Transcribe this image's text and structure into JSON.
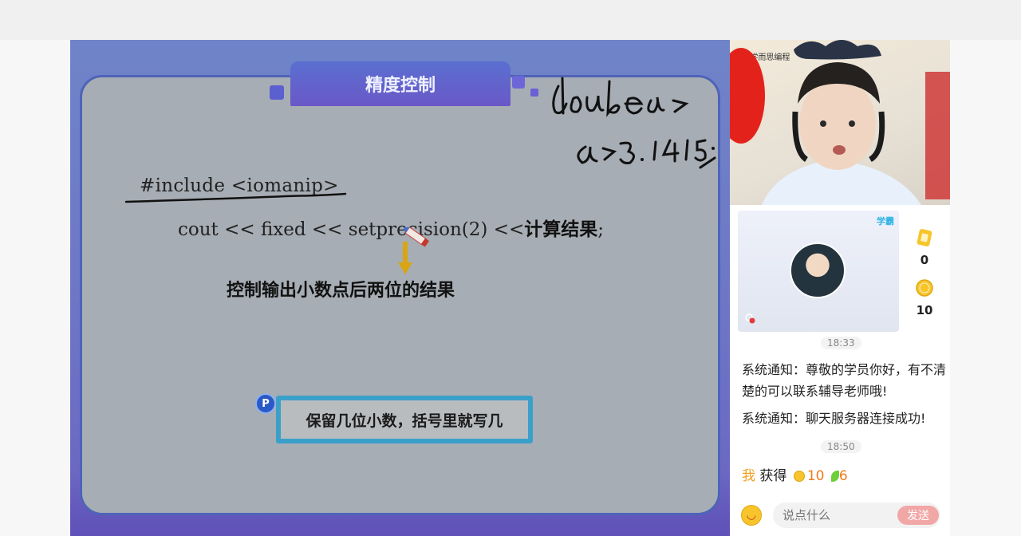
{
  "slide": {
    "title": "精度控制",
    "include_line": "#include <iomanip>",
    "code_prefix": "cout << fixed << setprecision(2) <<",
    "code_result": "计算结果",
    "code_suffix": ";",
    "explanation": "控制输出小数点后两位的结果",
    "hint": "保留几位小数，括号里就写几",
    "hint_badge": "P"
  },
  "teacher_video": {
    "logo": "学而思编程"
  },
  "self_video": {
    "tag": "学霸"
  },
  "stats": {
    "cards": "0",
    "coins": "10"
  },
  "chat": {
    "time1": "18:33",
    "msg1": "系统通知：尊敬的学员你好，有不清楚的可以联系辅导老师哦!",
    "msg2": "系统通知：聊天服务器连接成功!",
    "time2": "18:50",
    "reward_me": "我",
    "reward_verb": "获得",
    "reward_coins": "10",
    "reward_leaves": "6"
  },
  "composer": {
    "placeholder": "说点什么",
    "send_label": "发送"
  },
  "colors": {
    "board": "#a7adb4",
    "hint_border": "#3aa0c9",
    "send": "#f2a7a7"
  }
}
